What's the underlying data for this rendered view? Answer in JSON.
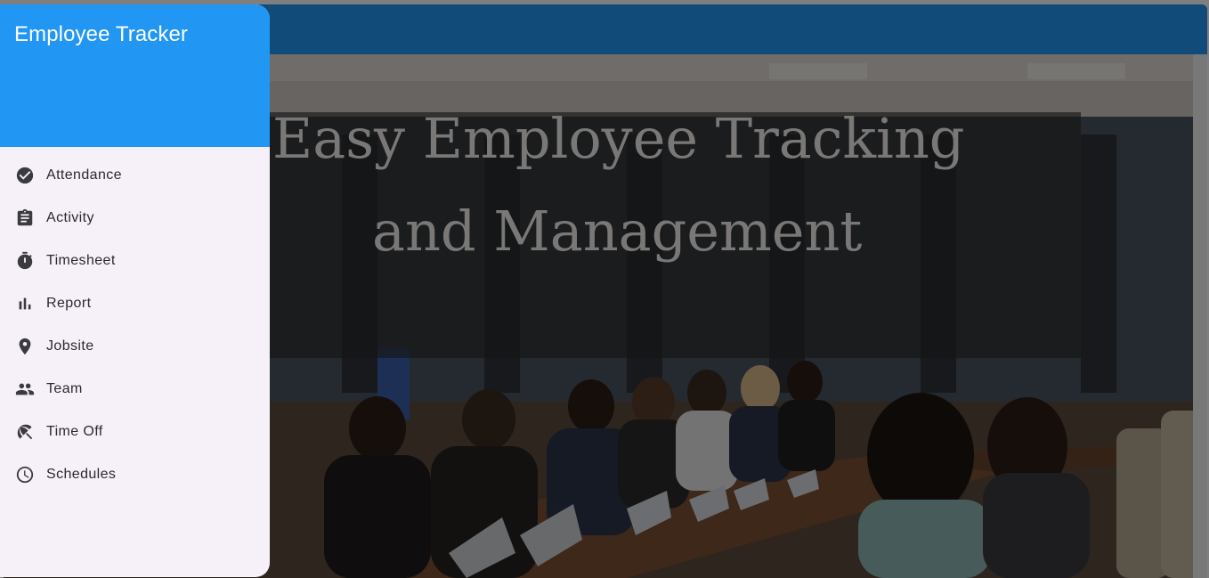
{
  "app": {
    "title": "Employee Tracker"
  },
  "hero": {
    "title_line1": "Easy Employee Tracking",
    "title_line2": "and Management"
  },
  "drawer": {
    "items": [
      {
        "label": "Attendance",
        "icon": "check-circle-icon"
      },
      {
        "label": "Activity",
        "icon": "clipboard-icon"
      },
      {
        "label": "Timesheet",
        "icon": "stopwatch-icon"
      },
      {
        "label": "Report",
        "icon": "bar-chart-icon"
      },
      {
        "label": "Jobsite",
        "icon": "location-pin-icon"
      },
      {
        "label": "Team",
        "icon": "people-icon"
      },
      {
        "label": "Time Off",
        "icon": "beach-umbrella-icon"
      },
      {
        "label": "Schedules",
        "icon": "clock-icon"
      }
    ]
  },
  "colors": {
    "primary": "#2196f3",
    "drawer_bg": "#f6f1f8",
    "text": "#2b2930"
  }
}
